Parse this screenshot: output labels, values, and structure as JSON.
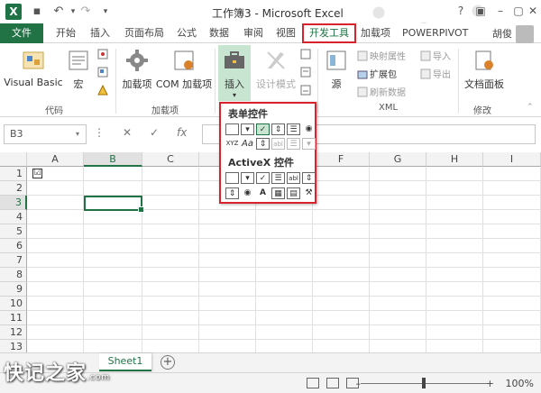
{
  "titlebar": {
    "title": "工作簿3 - Microsoft Excel",
    "app_icon": "X",
    "undo_icon": "↶",
    "redo_icon": "↷",
    "help": "?",
    "min": "–",
    "max": "▢",
    "close": "✕"
  },
  "tabs": [
    "文件",
    "开始",
    "插入",
    "页面布局",
    "公式",
    "数据",
    "审阅",
    "视图",
    "开发工具",
    "加载项",
    "POWERPIVOT"
  ],
  "user": "胡俊",
  "ribbon": {
    "visual_basic": "Visual Basic",
    "macro": "宏",
    "group_code": "代码",
    "addins": "加载项",
    "com_addins": "COM 加载项",
    "group_addins": "加载项",
    "insert": "插入",
    "design_mode": "设计模式",
    "source": "源",
    "map_props": "映射属性",
    "expansion_packs": "扩展包",
    "refresh_data": "刷新数据",
    "import": "导入",
    "export": "导出",
    "group_xml": "XML",
    "doc_panel": "文档面板",
    "group_modify": "修改"
  },
  "formula_bar": {
    "name_box": "B3",
    "cancel": "✕",
    "enter": "✓",
    "fx": "fx"
  },
  "grid": {
    "columns": [
      "A",
      "B",
      "C",
      "D",
      "E",
      "F",
      "G",
      "H",
      "I"
    ],
    "rows": [
      "1",
      "2",
      "3",
      "4",
      "5",
      "6",
      "7",
      "8",
      "9",
      "10",
      "11",
      "12",
      "13"
    ],
    "selected_column": "B",
    "selected_row": "3",
    "a1_checkbox": "☑"
  },
  "dropdown": {
    "form_controls_title": "表单控件",
    "activex_title": "ActiveX 控件",
    "label_aa": "Aa",
    "label_a": "A",
    "label_xyz": "XYZ",
    "label_abl": "abl"
  },
  "sheets": {
    "active": "Sheet1",
    "add": "+"
  },
  "statusbar": {
    "zoom": "100%",
    "zoom_level": 1.0
  },
  "watermark": {
    "text": "快记之家",
    "sub": ".com"
  },
  "colors": {
    "accent": "#217346",
    "highlight": "#d9232c"
  }
}
